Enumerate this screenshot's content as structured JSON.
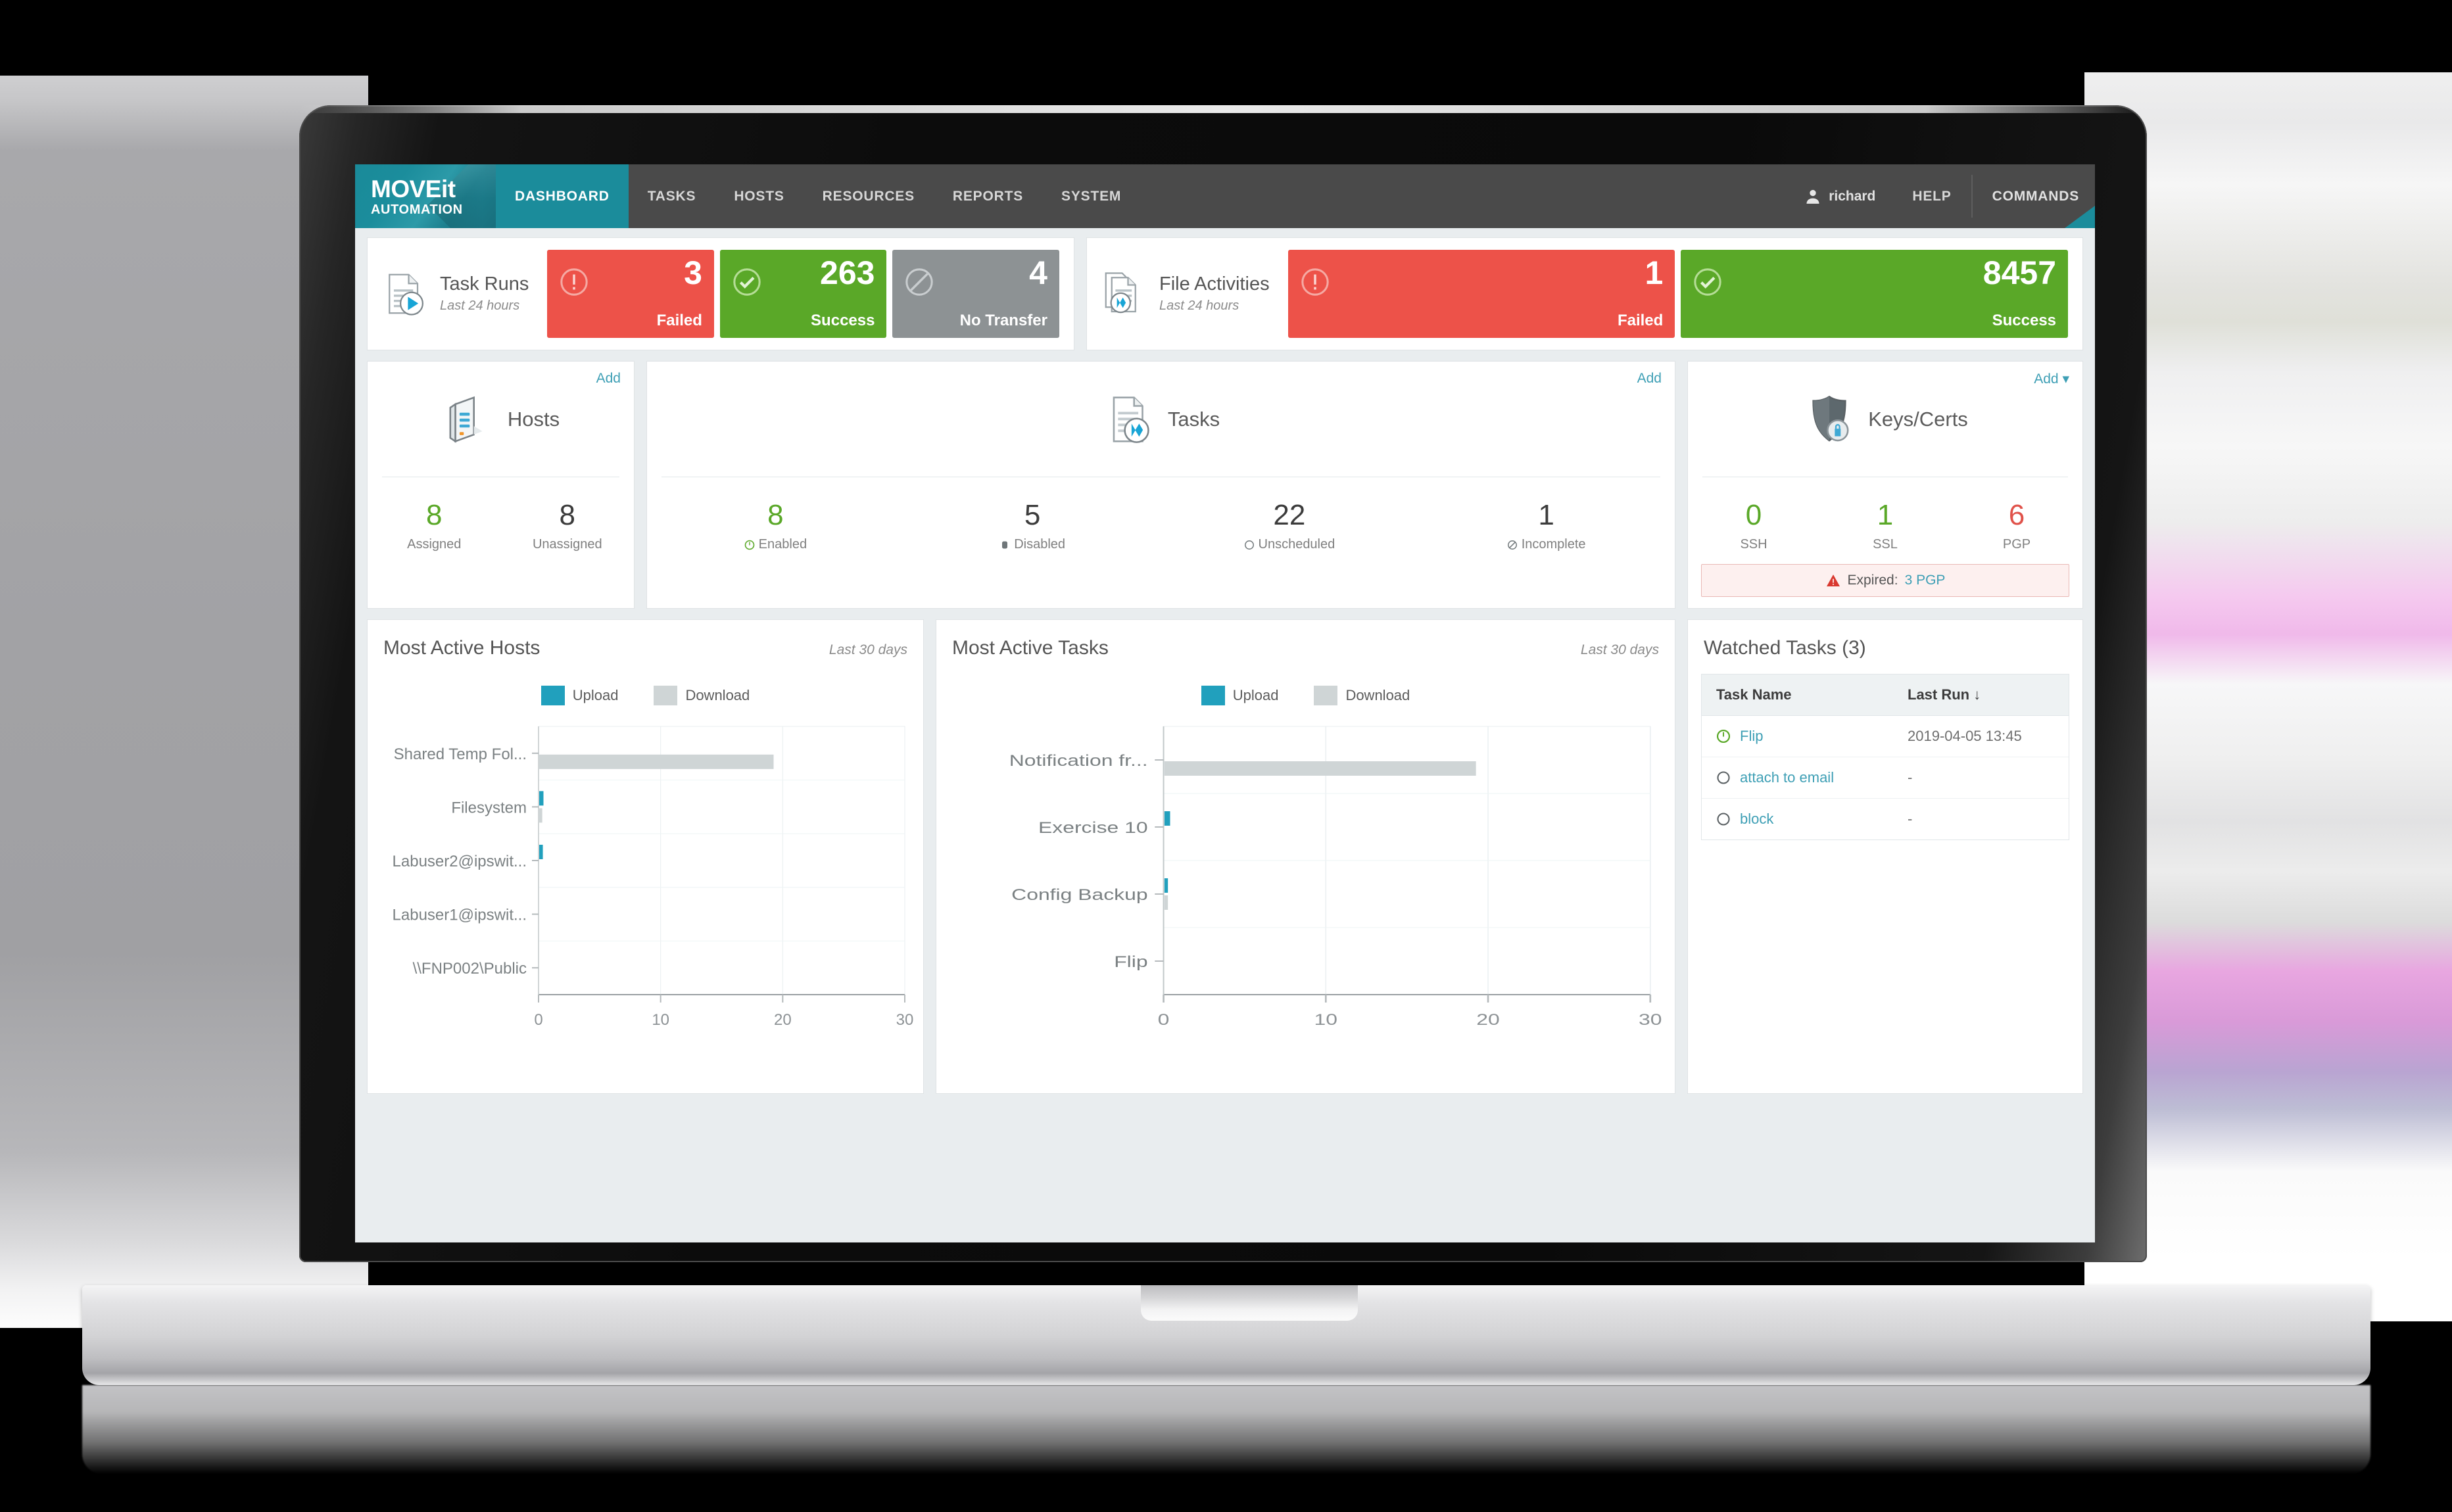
{
  "brand": {
    "line1": "MOVEit",
    "line2": "AUTOMATION"
  },
  "nav": {
    "items": [
      "DASHBOARD",
      "TASKS",
      "HOSTS",
      "RESOURCES",
      "REPORTS",
      "SYSTEM"
    ],
    "active": "DASHBOARD",
    "user": "richard",
    "help": "HELP",
    "commands": "COMMANDS"
  },
  "summary": {
    "task_runs": {
      "title": "Task Runs",
      "subtitle": "Last 24 hours",
      "tiles": [
        {
          "value": "3",
          "label": "Failed",
          "color": "#ed5249",
          "icon": "exclamation-circle-icon"
        },
        {
          "value": "263",
          "label": "Success",
          "color": "#5aa828",
          "icon": "check-circle-icon"
        },
        {
          "value": "4",
          "label": "No Transfer",
          "color": "#8d9294",
          "icon": "no-transfer-icon"
        }
      ]
    },
    "file_activities": {
      "title": "File Activities",
      "subtitle": "Last 24 hours",
      "tiles": [
        {
          "value": "1",
          "label": "Failed",
          "color": "#ed5249",
          "icon": "exclamation-circle-icon"
        },
        {
          "value": "8457",
          "label": "Success",
          "color": "#5aa828",
          "icon": "check-circle-icon"
        }
      ]
    }
  },
  "cards": {
    "hosts": {
      "add": "Add",
      "name": "Hosts",
      "stats": [
        {
          "value": "8",
          "label": "Assigned",
          "color": "green"
        },
        {
          "value": "8",
          "label": "Unassigned",
          "color": "dark"
        }
      ]
    },
    "tasks": {
      "add": "Add",
      "name": "Tasks",
      "stats": [
        {
          "value": "8",
          "label": "Enabled",
          "color": "green",
          "icon": "enabled-circle-icon"
        },
        {
          "value": "5",
          "label": "Disabled",
          "color": "dark",
          "icon": "disabled-square-icon"
        },
        {
          "value": "22",
          "label": "Unscheduled",
          "color": "dark",
          "icon": "unscheduled-circle-icon"
        },
        {
          "value": "1",
          "label": "Incomplete",
          "color": "dark",
          "icon": "incomplete-slash-icon"
        }
      ]
    },
    "keys": {
      "add": "Add ▾",
      "name": "Keys/Certs",
      "stats": [
        {
          "value": "0",
          "label": "SSH",
          "color": "green"
        },
        {
          "value": "1",
          "label": "SSL",
          "color": "green"
        },
        {
          "value": "6",
          "label": "PGP",
          "color": "red"
        }
      ],
      "alert_prefix": "Expired:",
      "alert_value": "3 PGP"
    }
  },
  "watched": {
    "title": "Watched Tasks (3)",
    "columns": [
      "Task Name",
      "Last Run ↓"
    ],
    "rows": [
      {
        "status": "enabled",
        "name": "Flip",
        "last_run": "2019-04-05 13:45"
      },
      {
        "status": "unscheduled",
        "name": "attach to email",
        "last_run": "-"
      },
      {
        "status": "unscheduled",
        "name": "block",
        "last_run": "-"
      }
    ]
  },
  "chart_data": [
    {
      "type": "bar",
      "orientation": "horizontal",
      "title": "Most Active Hosts",
      "subtitle": "Last 30 days",
      "categories": [
        "Shared Temp Fol...",
        "Filesystem",
        "Labuser2@ipswit...",
        "Labuser1@ipswit...",
        "\\\\FNP002\\Public"
      ],
      "series": [
        {
          "name": "Upload",
          "color": "#21a0bd",
          "values": [
            0,
            0.35,
            0.3,
            0,
            0
          ]
        },
        {
          "name": "Download",
          "color": "#cfd5d6",
          "values": [
            19.2,
            0.25,
            0,
            0,
            0
          ]
        }
      ],
      "xlabel": "",
      "ylabel": "",
      "xlim": [
        0,
        30
      ],
      "xticks": [
        0,
        10,
        20,
        30
      ],
      "grid": true,
      "legend_position": "top-center"
    },
    {
      "type": "bar",
      "orientation": "horizontal",
      "title": "Most Active Tasks",
      "subtitle": "Last 30 days",
      "categories": [
        "Notification fr...",
        "Exercise 10",
        "Config Backup",
        "Flip"
      ],
      "series": [
        {
          "name": "Upload",
          "color": "#21a0bd",
          "values": [
            0,
            0.35,
            0.15,
            0
          ]
        },
        {
          "name": "Download",
          "color": "#cfd5d6",
          "values": [
            19.2,
            0,
            0.1,
            0
          ]
        }
      ],
      "xlabel": "",
      "ylabel": "",
      "xlim": [
        0,
        30
      ],
      "xticks": [
        0,
        10,
        20,
        30
      ],
      "grid": true,
      "legend_position": "top-center"
    }
  ]
}
